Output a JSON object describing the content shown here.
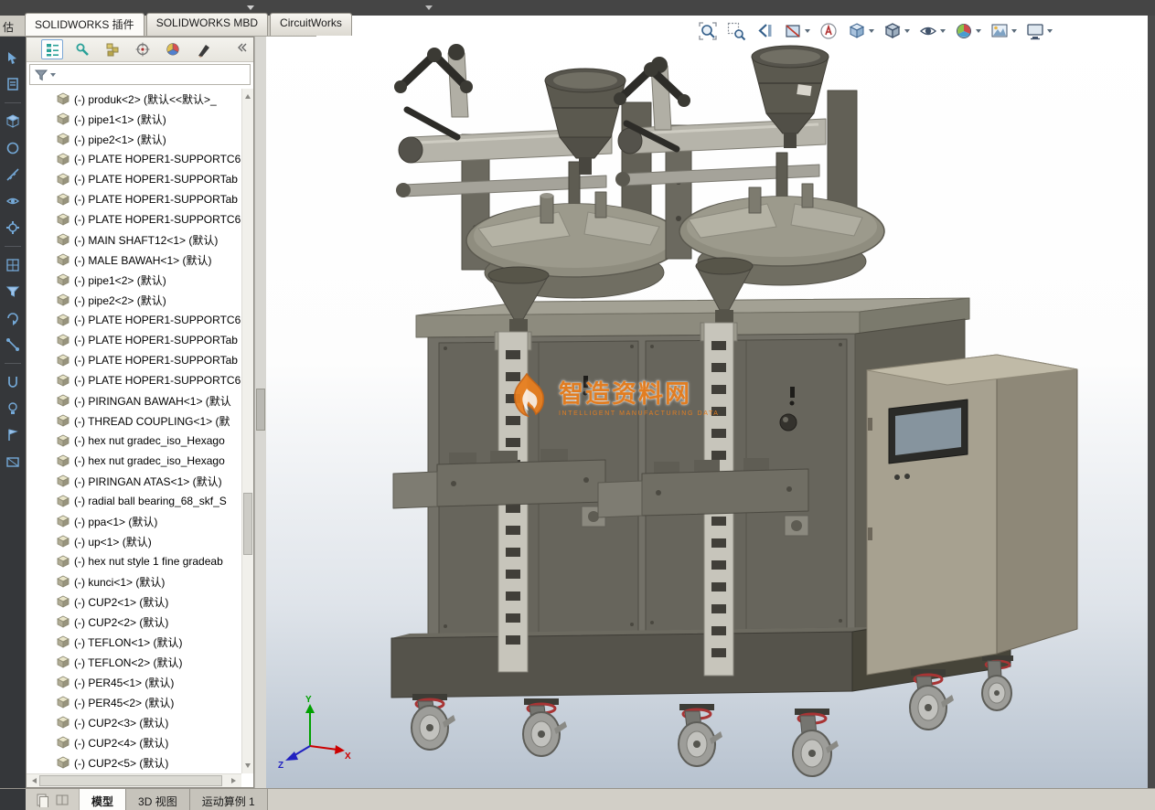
{
  "partial_tab": "估",
  "top_tabs": [
    "SOLIDWORKS 插件",
    "SOLIDWORKS MBD",
    "CircuitWorks"
  ],
  "panel": {
    "tab_icons": [
      "featuremanager",
      "propertymanager",
      "configurationmanager",
      "dimxpertmanager",
      "displaymanager",
      "appearances"
    ],
    "filter_value": ""
  },
  "tree": {
    "items": [
      "(-) produk<2> (默认<<默认>_",
      "(-) pipe1<1> (默认)",
      "(-) pipe2<1> (默认)",
      "(-) PLATE HOPER1-SUPPORTC6",
      "(-) PLATE HOPER1-SUPPORTab",
      "(-) PLATE HOPER1-SUPPORTab",
      "(-) PLATE HOPER1-SUPPORTC6",
      "(-) MAIN SHAFT12<1> (默认)",
      "(-) MALE BAWAH<1> (默认)",
      "(-) pipe1<2> (默认)",
      "(-) pipe2<2> (默认)",
      "(-) PLATE HOPER1-SUPPORTC6",
      "(-) PLATE HOPER1-SUPPORTab",
      "(-) PLATE HOPER1-SUPPORTab",
      "(-) PLATE HOPER1-SUPPORTC6",
      "(-) PIRINGAN BAWAH<1> (默认",
      "(-) THREAD COUPLING<1> (默",
      "(-) hex nut gradec_iso_Hexago",
      "(-) hex nut gradec_iso_Hexago",
      "(-) PIRINGAN ATAS<1> (默认)",
      "(-) radial ball bearing_68_skf_S",
      "(-) ppa<1> (默认)",
      "(-) up<1> (默认)",
      "(-) hex nut style 1 fine gradeab",
      "(-) kunci<1> (默认)",
      "(-) CUP2<1> (默认)",
      "(-) CUP2<2> (默认)",
      "(-) TEFLON<1> (默认)",
      "(-) TEFLON<2> (默认)",
      "(-) PER45<1> (默认)",
      "(-) PER45<2> (默认)",
      "(-) CUP2<3> (默认)",
      "(-) CUP2<4> (默认)",
      "(-) CUP2<5> (默认)"
    ]
  },
  "headsup": {
    "icons": [
      "zoom-fit",
      "zoom-area",
      "previous-view",
      "section-view",
      "annotation-view",
      "view-orientation",
      "display-style",
      "hide-show-items",
      "edit-appearance",
      "apply-scene",
      "view-settings"
    ]
  },
  "viewport": {
    "triad": {
      "x": "X",
      "y": "Y",
      "z": "Z"
    }
  },
  "watermark": {
    "title": "智造资料网",
    "subtitle": "INTELLIGENT MANUFACTURING DATA"
  },
  "statusbar": {
    "tabs": [
      "模型",
      "3D 视图",
      "运动算例 1"
    ]
  },
  "colors": {
    "accent_orange": "#e87f1f",
    "viewport_top": "#ffffff",
    "viewport_bottom": "#b7c2cf",
    "machine_body": "#8f8d7f",
    "cabinet_tan": "#a7a190"
  }
}
